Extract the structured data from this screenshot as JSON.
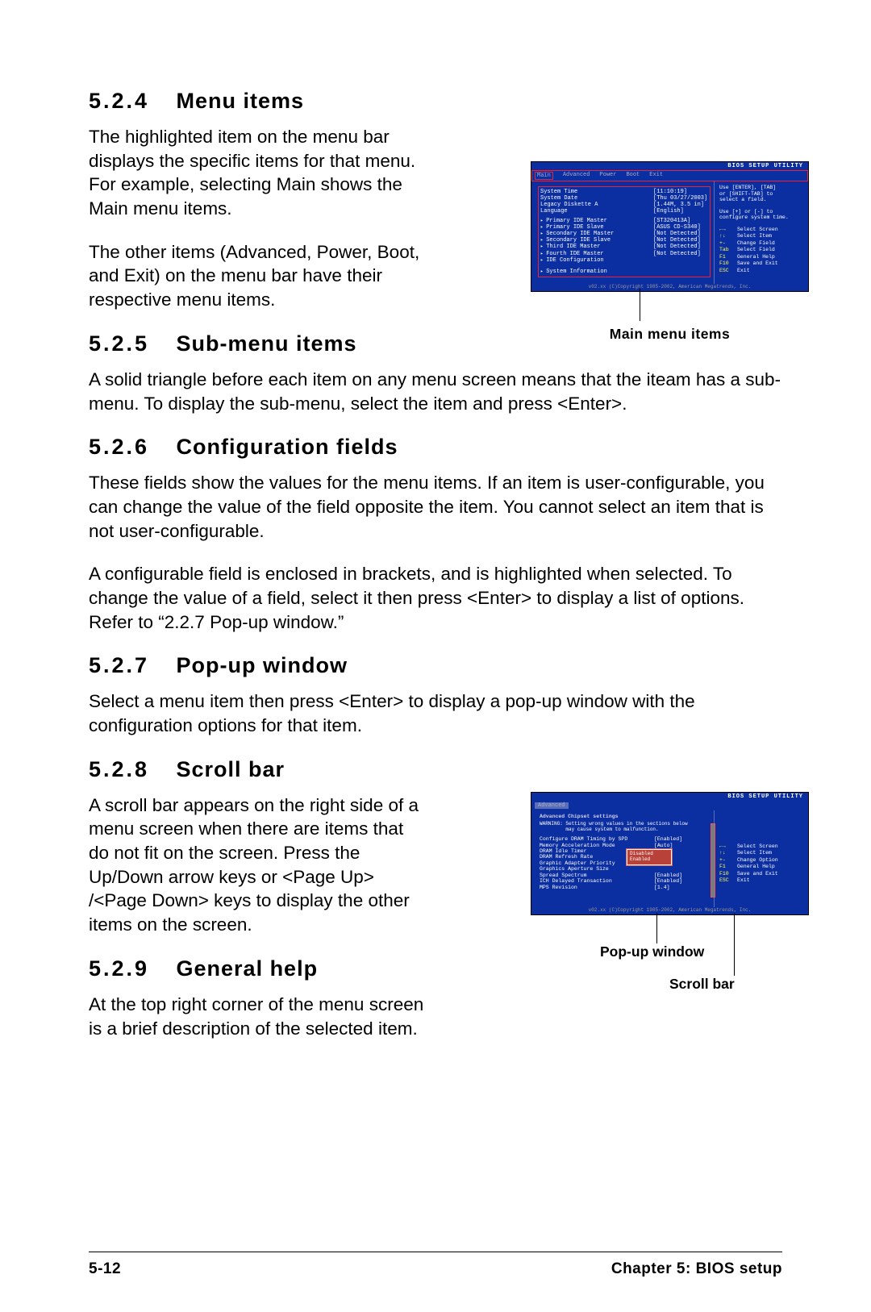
{
  "sections": {
    "s524": {
      "num": "5.2.4",
      "title": "Menu items"
    },
    "s525": {
      "num": "5.2.5",
      "title": "Sub-menu items"
    },
    "s526": {
      "num": "5.2.6",
      "title": "Configuration fields"
    },
    "s527": {
      "num": "5.2.7",
      "title": "Pop-up window"
    },
    "s528": {
      "num": "5.2.8",
      "title": "Scroll bar"
    },
    "s529": {
      "num": "5.2.9",
      "title": "General help"
    }
  },
  "paragraphs": {
    "p1": "The highlighted item on the menu bar displays the specific items for that menu. For example, selecting Main shows the Main menu items.",
    "p2": "The other items (Advanced, Power, Boot, and Exit) on the menu bar have their respective menu items.",
    "p3": "A solid triangle before each item on any menu screen means that the iteam has a sub-menu. To display the sub-menu, select the item and press <Enter>.",
    "p4": "These fields show the values for the menu items. If an item is user-configurable, you can change the value of the field opposite the item. You cannot select an item that is not user-configurable.",
    "p5": "A configurable field is enclosed in brackets, and is highlighted when selected. To change the value of a field, select it then press <Enter> to display a list of options. Refer to “2.2.7 Pop-up window.”",
    "p6": "Select a menu item then press <Enter> to display a pop-up window with the configuration options for that item.",
    "p7": "A scroll bar appears on the right side of a menu screen when there are items that do not fit on the screen. Press the Up/Down arrow keys or <Page Up> /<Page Down> keys to display the other items on the screen.",
    "p8": "At the top right corner of the menu screen is a brief description of the selected item."
  },
  "fig1": {
    "utility_title": "BIOS SETUP UTILITY",
    "tabs": [
      "Main",
      "Advanced",
      "Power",
      "Boot",
      "Exit"
    ],
    "rows_top": [
      {
        "label": "System Time",
        "value": "[11:10:19]"
      },
      {
        "label": "System Date",
        "value": "[Thu 03/27/2003]"
      },
      {
        "label": "Legacy Diskette A",
        "value": "[1.44M, 3.5 in]"
      },
      {
        "label": "Language",
        "value": "[English]"
      }
    ],
    "rows_sub": [
      {
        "label": "Primary IDE Master",
        "value": "[ST320413A]"
      },
      {
        "label": "Primary IDE Slave",
        "value": "[ASUS CD-S340]"
      },
      {
        "label": "Secondary IDE Master",
        "value": "[Not Detected]"
      },
      {
        "label": "Secondary IDE Slave",
        "value": "[Not Detected]"
      },
      {
        "label": "Third IDE Master",
        "value": "[Not Detected]"
      },
      {
        "label": "Fourth IDE Master",
        "value": "[Not Detected]"
      },
      {
        "label": "IDE Configuration",
        "value": ""
      }
    ],
    "rows_sys": {
      "label": "System Information",
      "value": ""
    },
    "help_top": "Use [ENTER], [TAB]\nor [SHIFT-TAB] to\nselect a field.\n\nUse [+] or [-] to\nconfigure system time.",
    "keys": [
      {
        "k": "←→",
        "d": "Select Screen"
      },
      {
        "k": "↑↓",
        "d": "Select Item"
      },
      {
        "k": "+-",
        "d": "Change Field"
      },
      {
        "k": "Tab",
        "d": "Select Field"
      },
      {
        "k": "F1",
        "d": "General Help"
      },
      {
        "k": "F10",
        "d": "Save and Exit"
      },
      {
        "k": "ESC",
        "d": "Exit"
      }
    ],
    "footer": "v02.xx (C)Copyright 1985-2002, American Megatrends, Inc.",
    "caption": "Main menu items"
  },
  "fig2": {
    "utility_title": "BIOS SETUP UTILITY",
    "active_tab": "Advanced",
    "heading": "Advanced Chipset settings",
    "warning": "WARNING: Setting wrong values in the sections below\n         may cause system to malfunction.",
    "rows": [
      {
        "label": "Configure DRAM Timing by SPD",
        "value": "[Enabled]"
      },
      {
        "label": "Memory Acceleration Mode",
        "value": "[Auto]"
      },
      {
        "label": "DRAM Idle Timer",
        "value": ""
      },
      {
        "label": "DRAM Refresh Rate",
        "value": ""
      },
      {
        "label": "",
        "value": ""
      },
      {
        "label": "Graphic Adapter Priority",
        "value": ""
      },
      {
        "label": "Graphics Aperture Size",
        "value": ""
      },
      {
        "label": "Spread Spectrum",
        "value": "[Enabled]"
      },
      {
        "label": "",
        "value": ""
      },
      {
        "label": "ICH Delayed Transaction",
        "value": "[Enabled]"
      },
      {
        "label": "",
        "value": ""
      },
      {
        "label": "MPS Revision",
        "value": "[1.4]"
      }
    ],
    "popup_options": [
      "Disabled",
      "Enabled"
    ],
    "keys": [
      {
        "k": "←→",
        "d": "Select Screen"
      },
      {
        "k": "↑↓",
        "d": "Select Item"
      },
      {
        "k": "+-",
        "d": "Change Option"
      },
      {
        "k": "F1",
        "d": "General Help"
      },
      {
        "k": "F10",
        "d": "Save and Exit"
      },
      {
        "k": "ESC",
        "d": "Exit"
      }
    ],
    "footer": "v02.xx (C)Copyright 1985-2002, American Megatrends, Inc.",
    "cap_popup": "Pop-up window",
    "cap_scroll": "Scroll bar"
  },
  "footer": {
    "page": "5-12",
    "chapter": "Chapter 5: BIOS setup"
  }
}
